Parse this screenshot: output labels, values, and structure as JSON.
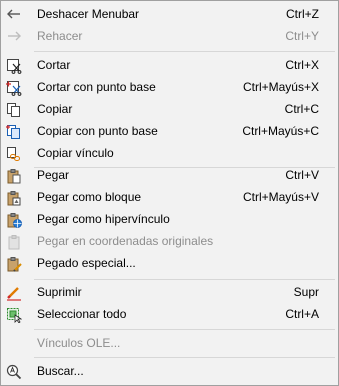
{
  "menu": {
    "items": [
      {
        "label": "Deshacer Menubar",
        "shortcut": "Ctrl+Z",
        "icon": "undo-icon",
        "enabled": true
      },
      {
        "label": "Rehacer",
        "shortcut": "Ctrl+Y",
        "icon": "redo-icon",
        "enabled": false
      },
      {
        "label": "Cortar",
        "shortcut": "Ctrl+X",
        "icon": "cut-icon",
        "enabled": true
      },
      {
        "label": "Cortar con punto base",
        "shortcut": "Ctrl+Mayús+X",
        "icon": "cut-basepoint-icon",
        "enabled": true
      },
      {
        "label": "Copiar",
        "shortcut": "Ctrl+C",
        "icon": "copy-icon",
        "enabled": true
      },
      {
        "label": "Copiar con punto base",
        "shortcut": "Ctrl+Mayús+C",
        "icon": "copy-basepoint-icon",
        "enabled": true
      },
      {
        "label": "Copiar vínculo",
        "shortcut": "",
        "icon": "copy-link-icon",
        "enabled": true
      },
      {
        "label": "Pegar",
        "shortcut": "Ctrl+V",
        "icon": "paste-icon",
        "enabled": true
      },
      {
        "label": "Pegar como bloque",
        "shortcut": "Ctrl+Mayús+V",
        "icon": "paste-block-icon",
        "enabled": true
      },
      {
        "label": "Pegar como hipervínculo",
        "shortcut": "",
        "icon": "paste-hyperlink-icon",
        "enabled": true
      },
      {
        "label": "Pegar en coordenadas originales",
        "shortcut": "",
        "icon": "paste-original-coords-icon",
        "enabled": false
      },
      {
        "label": "Pegado especial...",
        "shortcut": "",
        "icon": "paste-special-icon",
        "enabled": true
      },
      {
        "label": "Suprimir",
        "shortcut": "Supr",
        "icon": "erase-icon",
        "enabled": true
      },
      {
        "label": "Seleccionar todo",
        "shortcut": "Ctrl+A",
        "icon": "select-all-icon",
        "enabled": true
      },
      {
        "label": "Vínculos OLE...",
        "shortcut": "",
        "icon": "",
        "enabled": false
      },
      {
        "label": "Buscar...",
        "shortcut": "",
        "icon": "find-icon",
        "enabled": true
      }
    ]
  }
}
